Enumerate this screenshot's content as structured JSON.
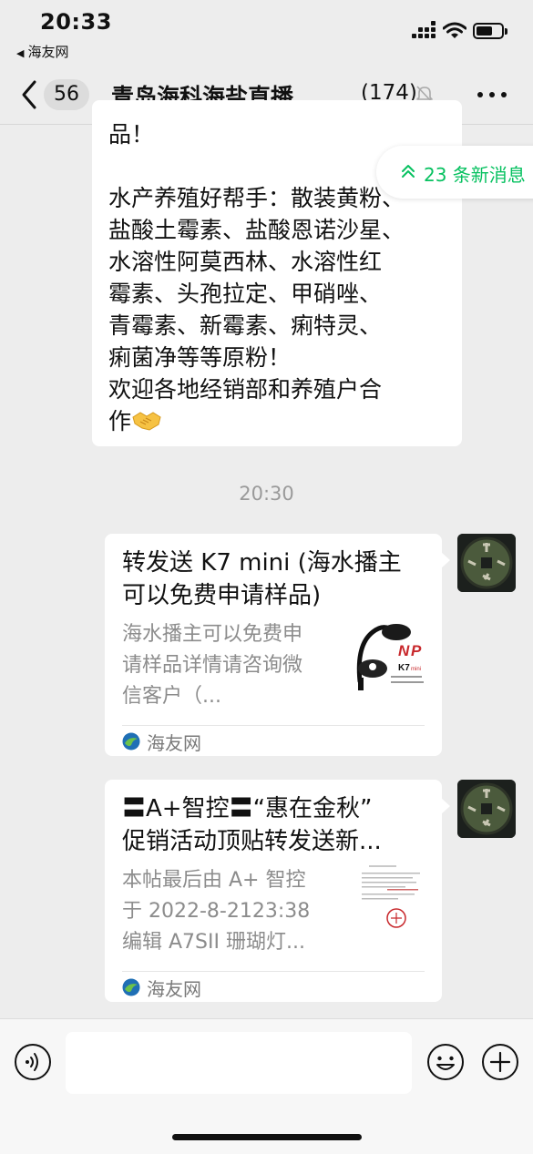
{
  "status_bar": {
    "time": "20:33",
    "back_app": "海友网"
  },
  "nav": {
    "unread_count": "56",
    "title": "青岛海科海盐直播...",
    "member_count": "(174)"
  },
  "text_message": {
    "lines": [
      "品！",
      "",
      "水产养殖好帮手：散装黄粉、",
      "盐酸土霉素、盐酸恩诺沙星、",
      "水溶性阿莫西林、水溶性红",
      "霉素、头孢拉定、甲硝唑、",
      "青霉素、新霉素、痢特灵、",
      "痢菌净等等原粉！",
      "欢迎各地经销部和养殖户合",
      "作"
    ]
  },
  "new_messages": {
    "label": "23 条新消息"
  },
  "timestamp": "20:30",
  "cards": [
    {
      "title_lines": [
        "转发送 K7 mini (海水播主",
        "可以免费申请样品)"
      ],
      "desc_lines": [
        "海水播主可以免费申",
        "请样品详情请咨询微",
        "信客户（..."
      ],
      "source": "海友网",
      "thumb_text": [
        "K7",
        "mini"
      ]
    },
    {
      "title_lines": [
        "〓A+智控〓“惠在金秋”",
        "促销活动顶贴转发送新..."
      ],
      "desc_lines": [
        "本帖最后由 A+ 智控",
        "于 2022-8-2123:38",
        "编辑 A7SII 珊瑚灯..."
      ],
      "source": "海友网"
    }
  ],
  "input": {
    "placeholder": ""
  },
  "colors": {
    "accent_green": "#07c160",
    "background": "#ededed"
  }
}
